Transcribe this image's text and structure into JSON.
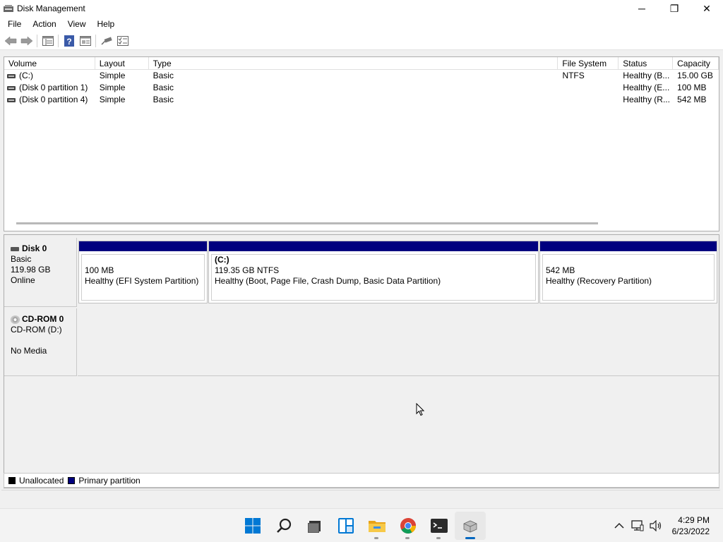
{
  "window": {
    "title": "Disk Management",
    "controls": {
      "minimize": "─",
      "restore": "❐",
      "close": "✕"
    }
  },
  "menu": [
    "File",
    "Action",
    "View",
    "Help"
  ],
  "toolbar": [
    "back-icon",
    "forward-icon",
    "disk-list-icon",
    "help-icon",
    "properties-icon",
    "connect-icon",
    "checklist-icon"
  ],
  "volume_table": {
    "columns": [
      "Volume",
      "Layout",
      "Type",
      "File System",
      "Status",
      "Capacity"
    ],
    "rows": [
      {
        "volume": "(C:)",
        "layout": "Simple",
        "type": "Basic",
        "fs": "NTFS",
        "status": "Healthy (B...",
        "capacity": "15.00 GB"
      },
      {
        "volume": "(Disk 0 partition 1)",
        "layout": "Simple",
        "type": "Basic",
        "fs": "",
        "status": "Healthy (E...",
        "capacity": "100 MB"
      },
      {
        "volume": "(Disk 0 partition 4)",
        "layout": "Simple",
        "type": "Basic",
        "fs": "",
        "status": "Healthy (R...",
        "capacity": "542 MB"
      }
    ]
  },
  "disks": {
    "disk0": {
      "name": "Disk 0",
      "type": "Basic",
      "size": "119.98 GB",
      "state": "Online",
      "partitions": [
        {
          "title": "",
          "size": "100 MB",
          "status": "Healthy (EFI System Partition)"
        },
        {
          "title": "(C:)",
          "size": "119.35 GB NTFS",
          "status": "Healthy (Boot, Page File, Crash Dump, Basic Data Partition)"
        },
        {
          "title": "",
          "size": "542 MB",
          "status": "Healthy (Recovery Partition)"
        }
      ]
    },
    "cdrom0": {
      "name": "CD-ROM 0",
      "type": "CD-ROM (D:)",
      "media": "No Media"
    }
  },
  "legend": [
    {
      "label": "Unallocated",
      "color": "#000000"
    },
    {
      "label": "Primary partition",
      "color": "#00007f"
    }
  ],
  "taskbar": {
    "apps": [
      "windows-start-icon",
      "search-icon",
      "task-view-icon",
      "widgets-icon",
      "file-explorer-icon",
      "chrome-icon",
      "terminal-icon",
      "disk-management-icon"
    ],
    "clock": {
      "time": "4:29 PM",
      "date": "6/23/2022"
    }
  },
  "colors": {
    "primary_partition": "#00007f",
    "accent": "#0067c0"
  }
}
